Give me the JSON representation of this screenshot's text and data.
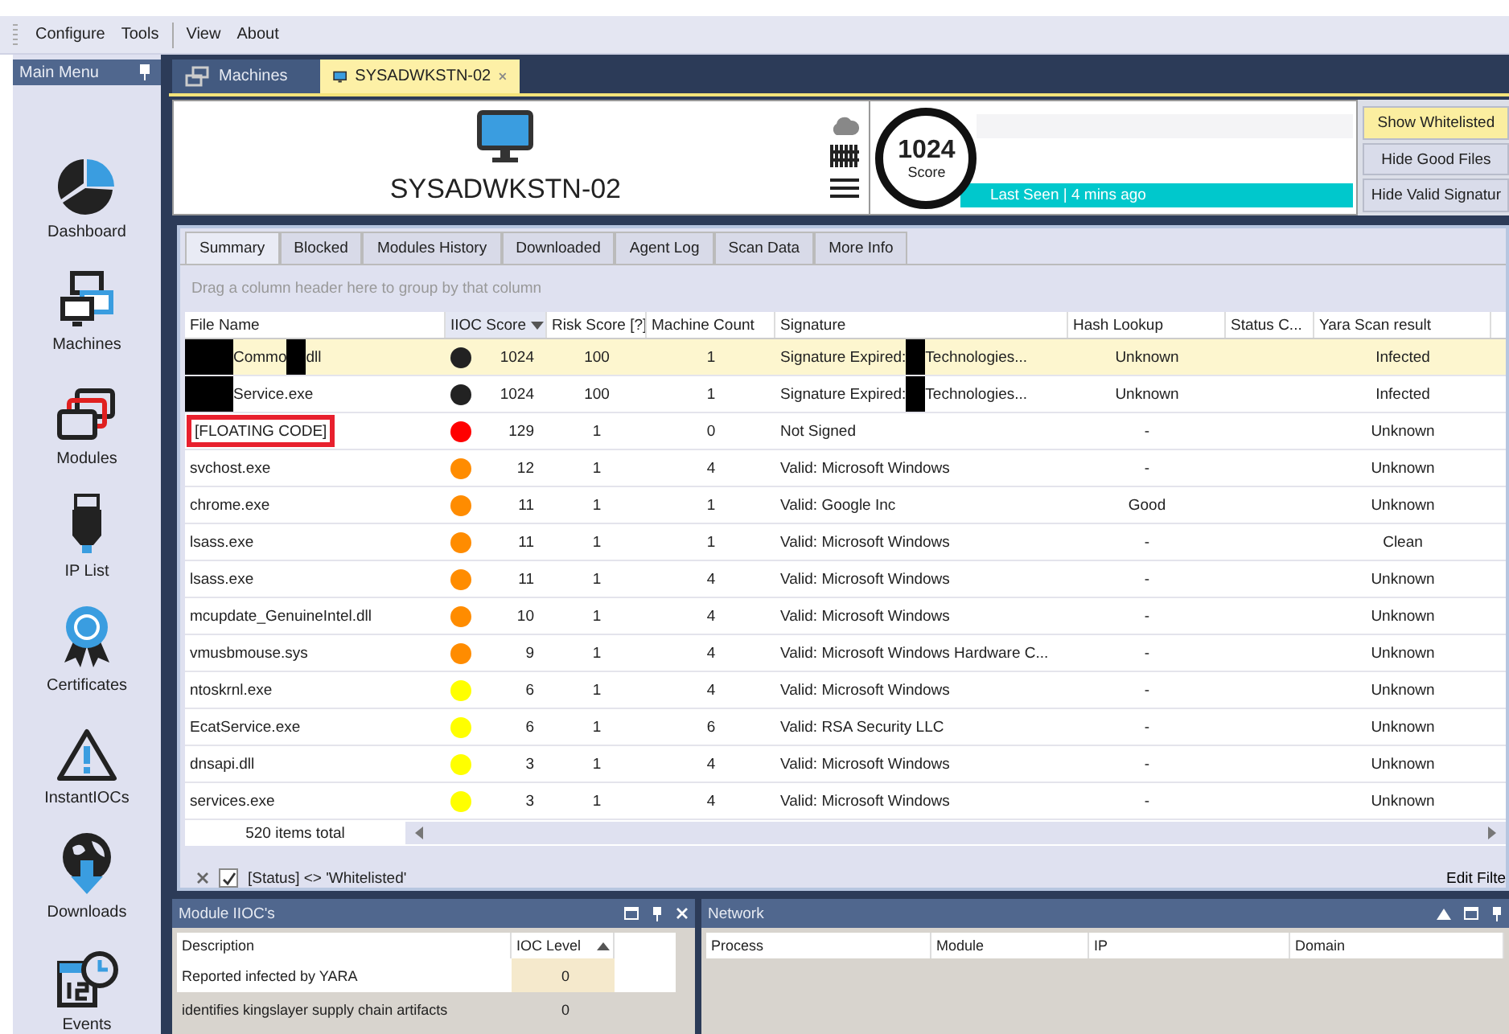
{
  "menu": [
    "Configure",
    "Tools",
    "View",
    "About"
  ],
  "sidebar": {
    "title": "Main Menu",
    "items": [
      {
        "kind": "dashboard",
        "label": "Dashboard"
      },
      {
        "kind": "machines",
        "label": "Machines"
      },
      {
        "kind": "modules",
        "label": "Modules"
      },
      {
        "kind": "iplist",
        "label": "IP List"
      },
      {
        "kind": "certificates",
        "label": "Certificates"
      },
      {
        "kind": "instantiocs",
        "label": "InstantIOCs"
      },
      {
        "kind": "downloads",
        "label": "Downloads"
      },
      {
        "kind": "events",
        "label": "Events"
      }
    ]
  },
  "doc_tabs": [
    {
      "label": "Machines",
      "kind": "machines",
      "selected": false
    },
    {
      "label": "SYSADWKSTN-02",
      "kind": "machine",
      "selected": true,
      "closable": true
    }
  ],
  "machine": {
    "name": "SYSADWKSTN-02",
    "score": "1024",
    "score_label": "Score",
    "last_seen": "Last Seen | 4 mins ago"
  },
  "filter_buttons": [
    {
      "label": "Show Whitelisted",
      "selected": true
    },
    {
      "label": "Hide Good Files",
      "selected": false
    },
    {
      "label": "Hide Valid Signatur",
      "selected": false
    }
  ],
  "tabs": [
    {
      "label": "Summary",
      "selected": true
    },
    {
      "label": "Blocked",
      "selected": false
    },
    {
      "label": "Modules History",
      "selected": false
    },
    {
      "label": "Downloaded",
      "selected": false
    },
    {
      "label": "Agent Log",
      "selected": false
    },
    {
      "label": "Scan Data",
      "selected": false
    },
    {
      "label": "More Info",
      "selected": false
    }
  ],
  "group_hint": "Drag a column header here to group by that column",
  "table": {
    "columns": [
      {
        "label": "File Name",
        "sorted_descending": false
      },
      {
        "label": "IIOC Score",
        "sorted_descending": true
      },
      {
        "label": "Risk Score [?]",
        "sorted_descending": false
      },
      {
        "label": "Machine Count",
        "sorted_descending": false
      },
      {
        "label": "Signature",
        "sorted_descending": false
      },
      {
        "label": "Hash Lookup",
        "sorted_descending": false
      },
      {
        "label": "Status C...",
        "sorted_descending": false
      },
      {
        "label": "Yara Scan result",
        "sorted_descending": false
      }
    ],
    "rows": [
      {
        "file_name": [
          {
            "kind": "redacted"
          },
          {
            "kind": "text",
            "text": "Commo"
          },
          {
            "kind": "redacted"
          },
          {
            "kind": "text",
            "text": "dll"
          }
        ],
        "color": "#222222",
        "iioc_score": "1024",
        "risk_score": "100",
        "machine_count": "1",
        "signature": [
          {
            "kind": "text",
            "text": "Signature Expired:"
          },
          {
            "kind": "redacted"
          },
          {
            "kind": "text",
            "text": "Technologies..."
          }
        ],
        "hash_lookup": "Unknown",
        "yara": "Infected",
        "selected": true,
        "outlined": false
      },
      {
        "file_name": [
          {
            "kind": "redacted"
          },
          {
            "kind": "text",
            "text": "Service.exe"
          }
        ],
        "color": "#222222",
        "iioc_score": "1024",
        "risk_score": "100",
        "machine_count": "1",
        "signature": [
          {
            "kind": "text",
            "text": "Signature Expired:"
          },
          {
            "kind": "redacted"
          },
          {
            "kind": "text",
            "text": "Technologies..."
          }
        ],
        "hash_lookup": "Unknown",
        "yara": "Infected",
        "selected": false,
        "outlined": false
      },
      {
        "file_name": [
          {
            "kind": "text",
            "text": "[FLOATING CODE]"
          }
        ],
        "color": "#ff0000",
        "iioc_score": "129",
        "risk_score": "1",
        "machine_count": "0",
        "signature": [
          {
            "kind": "text",
            "text": "Not Signed"
          }
        ],
        "hash_lookup": "-",
        "yara": "Unknown",
        "selected": false,
        "outlined": true
      },
      {
        "file_name": [
          {
            "kind": "text",
            "text": "svchost.exe"
          }
        ],
        "color": "#ff8c00",
        "iioc_score": "12",
        "risk_score": "1",
        "machine_count": "4",
        "signature": [
          {
            "kind": "text",
            "text": "Valid: Microsoft Windows"
          }
        ],
        "hash_lookup": "-",
        "yara": "Unknown",
        "selected": false,
        "outlined": false
      },
      {
        "file_name": [
          {
            "kind": "text",
            "text": "chrome.exe"
          }
        ],
        "color": "#ff8c00",
        "iioc_score": "11",
        "risk_score": "1",
        "machine_count": "1",
        "signature": [
          {
            "kind": "text",
            "text": "Valid: Google Inc"
          }
        ],
        "hash_lookup": "Good",
        "yara": "Unknown",
        "selected": false,
        "outlined": false
      },
      {
        "file_name": [
          {
            "kind": "text",
            "text": "lsass.exe"
          }
        ],
        "color": "#ff8c00",
        "iioc_score": "11",
        "risk_score": "1",
        "machine_count": "1",
        "signature": [
          {
            "kind": "text",
            "text": "Valid: Microsoft Windows"
          }
        ],
        "hash_lookup": "-",
        "yara": "Clean",
        "selected": false,
        "outlined": false
      },
      {
        "file_name": [
          {
            "kind": "text",
            "text": "lsass.exe"
          }
        ],
        "color": "#ff8c00",
        "iioc_score": "11",
        "risk_score": "1",
        "machine_count": "4",
        "signature": [
          {
            "kind": "text",
            "text": "Valid: Microsoft Windows"
          }
        ],
        "hash_lookup": "-",
        "yara": "Unknown",
        "selected": false,
        "outlined": false
      },
      {
        "file_name": [
          {
            "kind": "text",
            "text": "mcupdate_GenuineIntel.dll"
          }
        ],
        "color": "#ff8c00",
        "iioc_score": "10",
        "risk_score": "1",
        "machine_count": "4",
        "signature": [
          {
            "kind": "text",
            "text": "Valid: Microsoft Windows"
          }
        ],
        "hash_lookup": "-",
        "yara": "Unknown",
        "selected": false,
        "outlined": false
      },
      {
        "file_name": [
          {
            "kind": "text",
            "text": "vmusbmouse.sys"
          }
        ],
        "color": "#ff8c00",
        "iioc_score": "9",
        "risk_score": "1",
        "machine_count": "4",
        "signature": [
          {
            "kind": "text",
            "text": "Valid: Microsoft Windows Hardware C..."
          }
        ],
        "hash_lookup": "-",
        "yara": "Unknown",
        "selected": false,
        "outlined": false
      },
      {
        "file_name": [
          {
            "kind": "text",
            "text": "ntoskrnl.exe"
          }
        ],
        "color": "#ffff00",
        "iioc_score": "6",
        "risk_score": "1",
        "machine_count": "4",
        "signature": [
          {
            "kind": "text",
            "text": "Valid: Microsoft Windows"
          }
        ],
        "hash_lookup": "-",
        "yara": "Unknown",
        "selected": false,
        "outlined": false
      },
      {
        "file_name": [
          {
            "kind": "text",
            "text": "EcatService.exe"
          }
        ],
        "color": "#ffff00",
        "iioc_score": "6",
        "risk_score": "1",
        "machine_count": "6",
        "signature": [
          {
            "kind": "text",
            "text": "Valid: RSA Security LLC"
          }
        ],
        "hash_lookup": "-",
        "yara": "Unknown",
        "selected": false,
        "outlined": false
      },
      {
        "file_name": [
          {
            "kind": "text",
            "text": "dnsapi.dll"
          }
        ],
        "color": "#ffff00",
        "iioc_score": "3",
        "risk_score": "1",
        "machine_count": "4",
        "signature": [
          {
            "kind": "text",
            "text": "Valid: Microsoft Windows"
          }
        ],
        "hash_lookup": "-",
        "yara": "Unknown",
        "selected": false,
        "outlined": false
      },
      {
        "file_name": [
          {
            "kind": "text",
            "text": "services.exe"
          }
        ],
        "color": "#ffff00",
        "iioc_score": "3",
        "risk_score": "1",
        "machine_count": "4",
        "signature": [
          {
            "kind": "text",
            "text": "Valid: Microsoft Windows"
          }
        ],
        "hash_lookup": "-",
        "yara": "Unknown",
        "selected": false,
        "outlined": false
      }
    ],
    "total": "520 items total"
  },
  "filter": {
    "checked": true,
    "text": "[Status] <> 'Whitelisted'",
    "edit": "Edit Filte"
  },
  "module_iiocs": {
    "title": "Module IIOC's",
    "columns": [
      {
        "label": "Description",
        "sorted_ascending": false
      },
      {
        "label": "IOC Level",
        "sorted_ascending": true
      }
    ],
    "rows": [
      {
        "description": "Reported infected by YARA",
        "level": "0",
        "selected": true
      },
      {
        "description": "identifies kingslayer supply chain artifacts",
        "level": "0",
        "selected": false
      }
    ]
  },
  "network": {
    "title": "Network",
    "columns": [
      "Process",
      "Module",
      "IP",
      "Domain"
    ]
  }
}
